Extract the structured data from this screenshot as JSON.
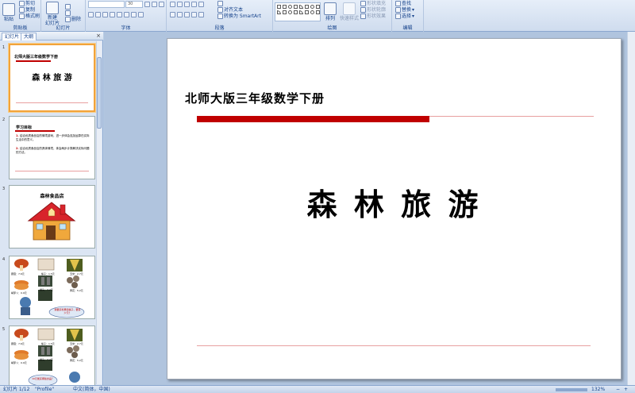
{
  "ribbon": {
    "clipboard": {
      "paste": "粘贴",
      "cut": "剪切",
      "copy": "复制",
      "format_painter": "格式刷",
      "label": "剪贴板"
    },
    "slides": {
      "new_slide": "新建\n幻灯片",
      "delete": "删除",
      "label": "幻灯片"
    },
    "font": {
      "name_value": "",
      "size_value": "30",
      "label": "字体"
    },
    "paragraph": {
      "align_text": "对齐文本",
      "convert_smartart": "转换为 SmartArt",
      "label": "段落"
    },
    "drawing": {
      "arrange": "排列",
      "quick_styles": "快速样式",
      "shape_fill": "形状填充",
      "shape_outline": "形状轮廓",
      "shape_effects": "形状效果",
      "label": "绘图"
    },
    "editing": {
      "find": "查找",
      "replace": "替换",
      "select": "选择",
      "label": "编辑"
    }
  },
  "pane": {
    "tab_slides": "幻灯片",
    "tab_outline": "大纲",
    "close": "×",
    "thumbs": [
      {
        "num": "1",
        "subtitle": "北师大版三年级数学下册",
        "title": "森 林 旅 游"
      },
      {
        "num": "2",
        "title": "学习目标",
        "items": [
          "结合优质食品店的情境游戏，进一步体会连加运算在实际生活中的意义。",
          "结合优质食品店的具体情境，体会两步计算解决实际问题的方法。"
        ]
      },
      {
        "num": "3",
        "title": "森林食品店"
      },
      {
        "num": "4",
        "prices": [
          "蘑菇：7.6元",
          "榛子：1.5元",
          "玉米：2.7元",
          "黄花：5.2元",
          "胡萝卜：0.9元",
          "罐头：3.2元"
        ],
        "bubble": "我要买松果和榛子，要多少元？"
      },
      {
        "num": "5",
        "prices": [
          "蘑菇：7.6元",
          "榛子：1.5元",
          "玉米：2.7元",
          "黄花：5.2元",
          "胡萝卜：0.9元",
          "罐头：3.2元"
        ],
        "bubble": "10元能买哪些食品？"
      }
    ]
  },
  "slide": {
    "subtitle": "北师大版三年级数学下册",
    "title": "森 林 旅 游"
  },
  "status": {
    "slide_pos": "幻灯片 1/12",
    "theme": "\"Profile\"",
    "lang": "中文(简体，中国)",
    "zoom": "132%"
  },
  "colors": {
    "accent_red": "#c00000",
    "line_red": "#e8a0a0"
  }
}
